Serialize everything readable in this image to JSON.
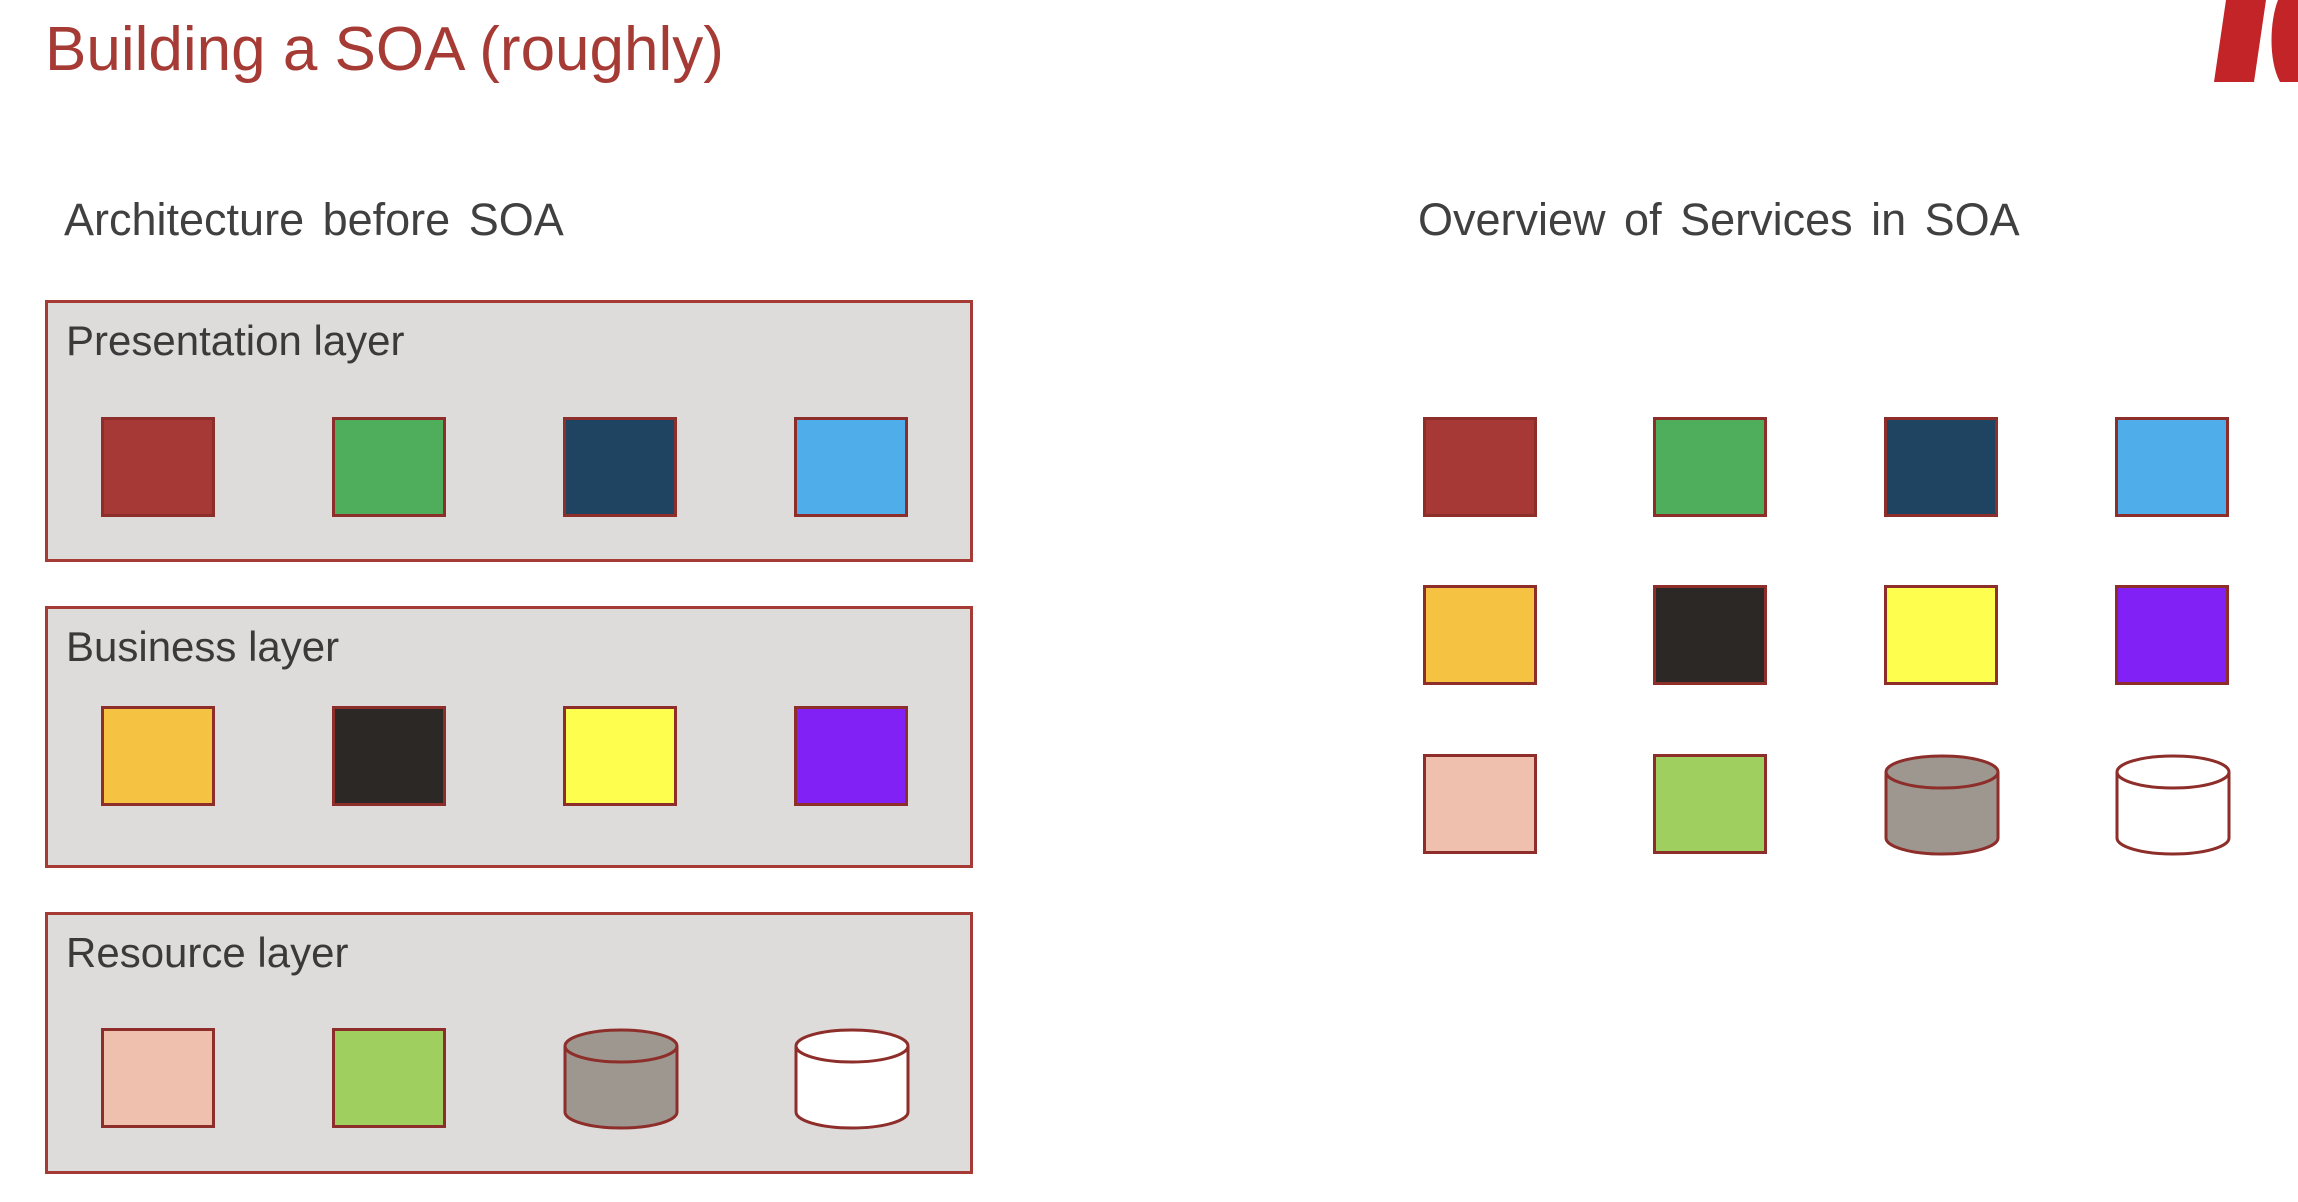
{
  "slide": {
    "title": "Building a SOA (roughly)"
  },
  "left_section": {
    "heading": "Architecture before SOA",
    "layers": [
      {
        "label": "Presentation layer",
        "items": [
          {
            "shape": "square",
            "color": "#a63935"
          },
          {
            "shape": "square",
            "color": "#4fae5b"
          },
          {
            "shape": "square",
            "color": "#1f4461"
          },
          {
            "shape": "square",
            "color": "#4faeea"
          }
        ]
      },
      {
        "label": "Business layer",
        "items": [
          {
            "shape": "square",
            "color": "#f5c242"
          },
          {
            "shape": "square",
            "color": "#2b2826"
          },
          {
            "shape": "square",
            "color": "#fdfe4e"
          },
          {
            "shape": "square",
            "color": "#8221f5"
          }
        ]
      },
      {
        "label": "Resource layer",
        "items": [
          {
            "shape": "square",
            "color": "#f0c0ae"
          },
          {
            "shape": "square",
            "color": "#9ecf5f"
          },
          {
            "shape": "cylinder",
            "color": "#9d9790"
          },
          {
            "shape": "cylinder",
            "color": "#ffffff"
          }
        ]
      }
    ]
  },
  "right_section": {
    "heading": "Overview of Services in SOA",
    "rows": [
      [
        {
          "shape": "square",
          "color": "#a63935"
        },
        {
          "shape": "square",
          "color": "#4fae5b"
        },
        {
          "shape": "square",
          "color": "#1f4461"
        },
        {
          "shape": "square",
          "color": "#4faeea"
        }
      ],
      [
        {
          "shape": "square",
          "color": "#f5c242"
        },
        {
          "shape": "square",
          "color": "#2b2826"
        },
        {
          "shape": "square",
          "color": "#fdfe4e"
        },
        {
          "shape": "square",
          "color": "#8221f5"
        }
      ],
      [
        {
          "shape": "square",
          "color": "#f0c0ae"
        },
        {
          "shape": "square",
          "color": "#9ecf5f"
        },
        {
          "shape": "cylinder",
          "color": "#9d9790"
        },
        {
          "shape": "cylinder",
          "color": "#ffffff"
        }
      ]
    ]
  },
  "colors": {
    "accent": "#a63b35",
    "layer_background": "#dedcdb",
    "outline": "#8e2e2a"
  }
}
